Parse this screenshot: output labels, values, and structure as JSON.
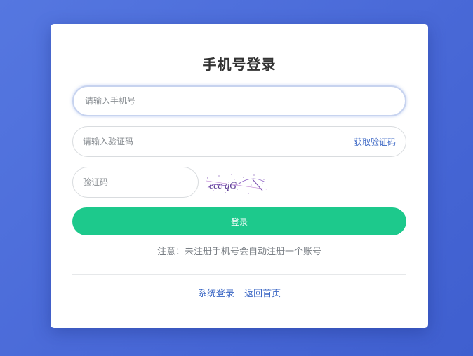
{
  "title": "手机号登录",
  "phone": {
    "value": "",
    "placeholder": "请输入手机号"
  },
  "sms_code": {
    "value": "",
    "placeholder": "请输入验证码",
    "get_code_label": "获取验证码"
  },
  "captcha": {
    "value": "",
    "placeholder": "验证码",
    "image_text": "ecc qG"
  },
  "login_button": "登录",
  "notice": "注意：未注册手机号会自动注册一个账号",
  "footer": {
    "system_login": "系统登录",
    "back_home": "返回首页"
  },
  "colors": {
    "primary": "#1dc98c",
    "link": "#3a66c4",
    "background": "#4a6ad8"
  }
}
